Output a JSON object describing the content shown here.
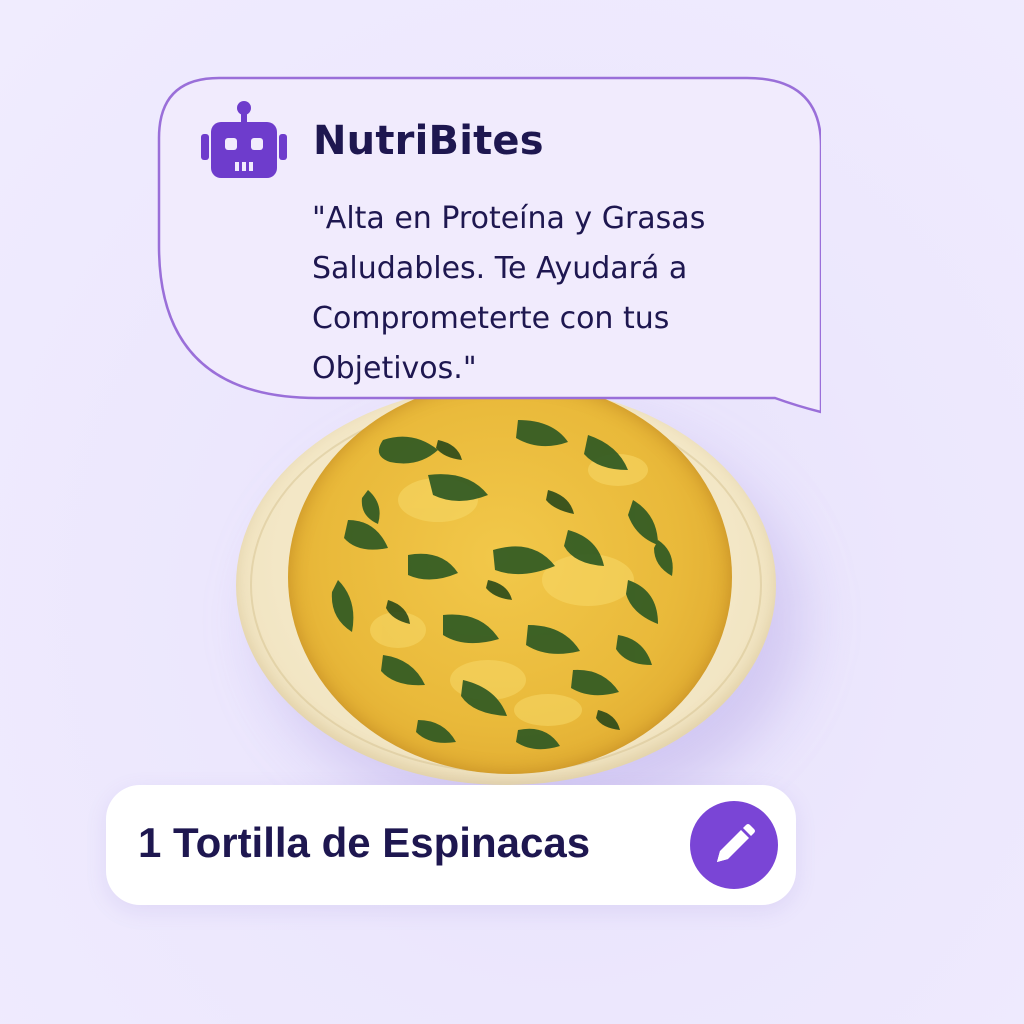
{
  "assistant": {
    "name": "NutriBites",
    "avatar_icon": "robot-icon",
    "message": "\"Alta en Proteína y Grasas Saludables. Te Ayudará a Comprometerte con tus Objetivos.\""
  },
  "food_item": {
    "label": "1 Tortilla de Espinacas",
    "edit_icon": "pencil-icon"
  },
  "colors": {
    "background": "#ece7fd",
    "accent": "#7a45d6",
    "text": "#1e1750",
    "bubble_border": "#9a6fd9"
  }
}
